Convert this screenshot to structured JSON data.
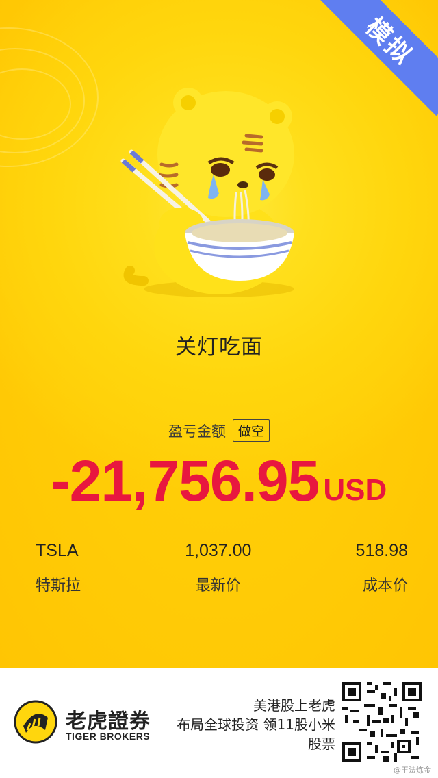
{
  "badge": {
    "label": "模拟",
    "color": "#5f7ef0"
  },
  "caption": "关灯吃面",
  "pnl": {
    "label": "盈亏金额",
    "tag": "做空",
    "amount": "-21,756.95",
    "currency": "USD",
    "color": "#e8173f"
  },
  "stats": {
    "ticker": "TSLA",
    "ticker_name": "特斯拉",
    "latest_price": "1,037.00",
    "latest_price_label": "最新价",
    "cost_price": "518.98",
    "cost_price_label": "成本价"
  },
  "footer": {
    "brand_cn": "老虎證券",
    "brand_en": "TIGER BROKERS",
    "promo_line1": "美港股上老虎",
    "promo_line2": "布局全球投资 领11股小米",
    "promo_line3": "股票",
    "watermark": "@王法炼金"
  },
  "icons": {
    "logo": "tiger-logo-icon",
    "qr": "qr-code",
    "mascot": "crying-tiger-mascot"
  }
}
